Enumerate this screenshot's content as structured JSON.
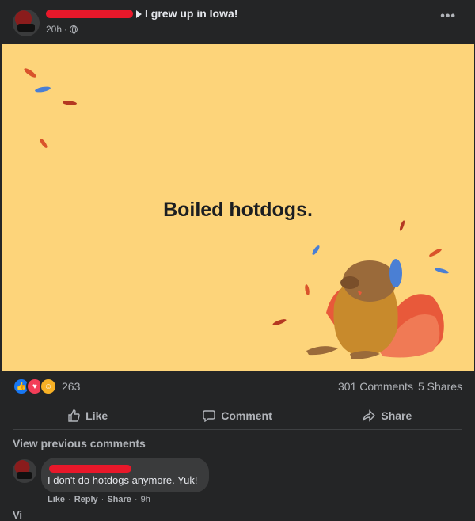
{
  "post": {
    "group_name": "I grew up in Iowa!",
    "time": "20h",
    "more_label": "•••",
    "card_text": "Boiled hotdogs."
  },
  "reactions": {
    "count": "263",
    "icons": [
      "like-icon",
      "love-icon",
      "haha-icon"
    ],
    "comments": "301 Comments",
    "shares": "5 Shares"
  },
  "actions": {
    "like": "Like",
    "comment": "Comment",
    "share": "Share"
  },
  "comments": {
    "view_previous": "View previous comments",
    "items": [
      {
        "text": "I don't do hotdogs anymore. Yuk!",
        "like": "Like",
        "reply": "Reply",
        "share": "Share",
        "time": "9h"
      }
    ],
    "more": "Vi"
  },
  "colors": {
    "background": "#242526",
    "card_background": "#fdd47a",
    "redaction": "#e8182a",
    "like_blue": "#1877f2",
    "love_red": "#f33e58",
    "haha_yellow": "#f7b125"
  }
}
